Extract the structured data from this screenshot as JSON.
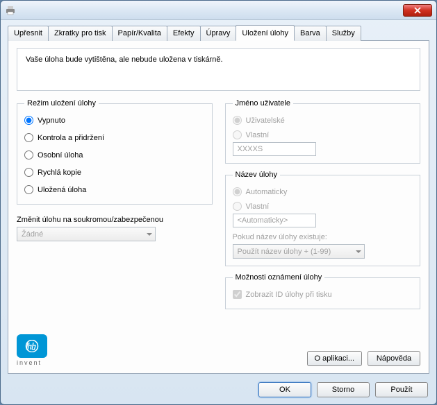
{
  "tabs": [
    "Upřesnit",
    "Zkratky pro tisk",
    "Papír/Kvalita",
    "Efekty",
    "Úpravy",
    "Uložení úlohy",
    "Barva",
    "Služby"
  ],
  "active_tab_index": 5,
  "info_text": "Vaše úloha bude vytištěna, ale nebude uložena v tiskárně.",
  "storage_mode": {
    "legend": "Režim uložení úlohy",
    "options": [
      "Vypnuto",
      "Kontrola a přidržení",
      "Osobní úloha",
      "Rychlá kopie",
      "Uložená úloha"
    ],
    "selected": 0
  },
  "make_private": {
    "label": "Změnit úlohu na soukromou/zabezpečenou",
    "value": "Žádné"
  },
  "user_name": {
    "legend": "Jméno uživatele",
    "options": [
      "Uživatelské",
      "Vlastní"
    ],
    "selected": 0,
    "custom_value": "XXXXS"
  },
  "job_name": {
    "legend": "Název úlohy",
    "options": [
      "Automaticky",
      "Vlastní"
    ],
    "selected": 0,
    "custom_value": "<Automaticky>",
    "exists_label": "Pokud název úlohy existuje:",
    "exists_value": "Použít název úlohy + (1-99)"
  },
  "notification": {
    "legend": "Možnosti oznámení úlohy",
    "show_id": "Zobrazit ID úlohy při tisku",
    "checked": true
  },
  "logo_sub": "invent",
  "buttons": {
    "about": "O aplikaci...",
    "help": "Nápověda",
    "ok": "OK",
    "cancel": "Storno",
    "apply": "Použít"
  }
}
